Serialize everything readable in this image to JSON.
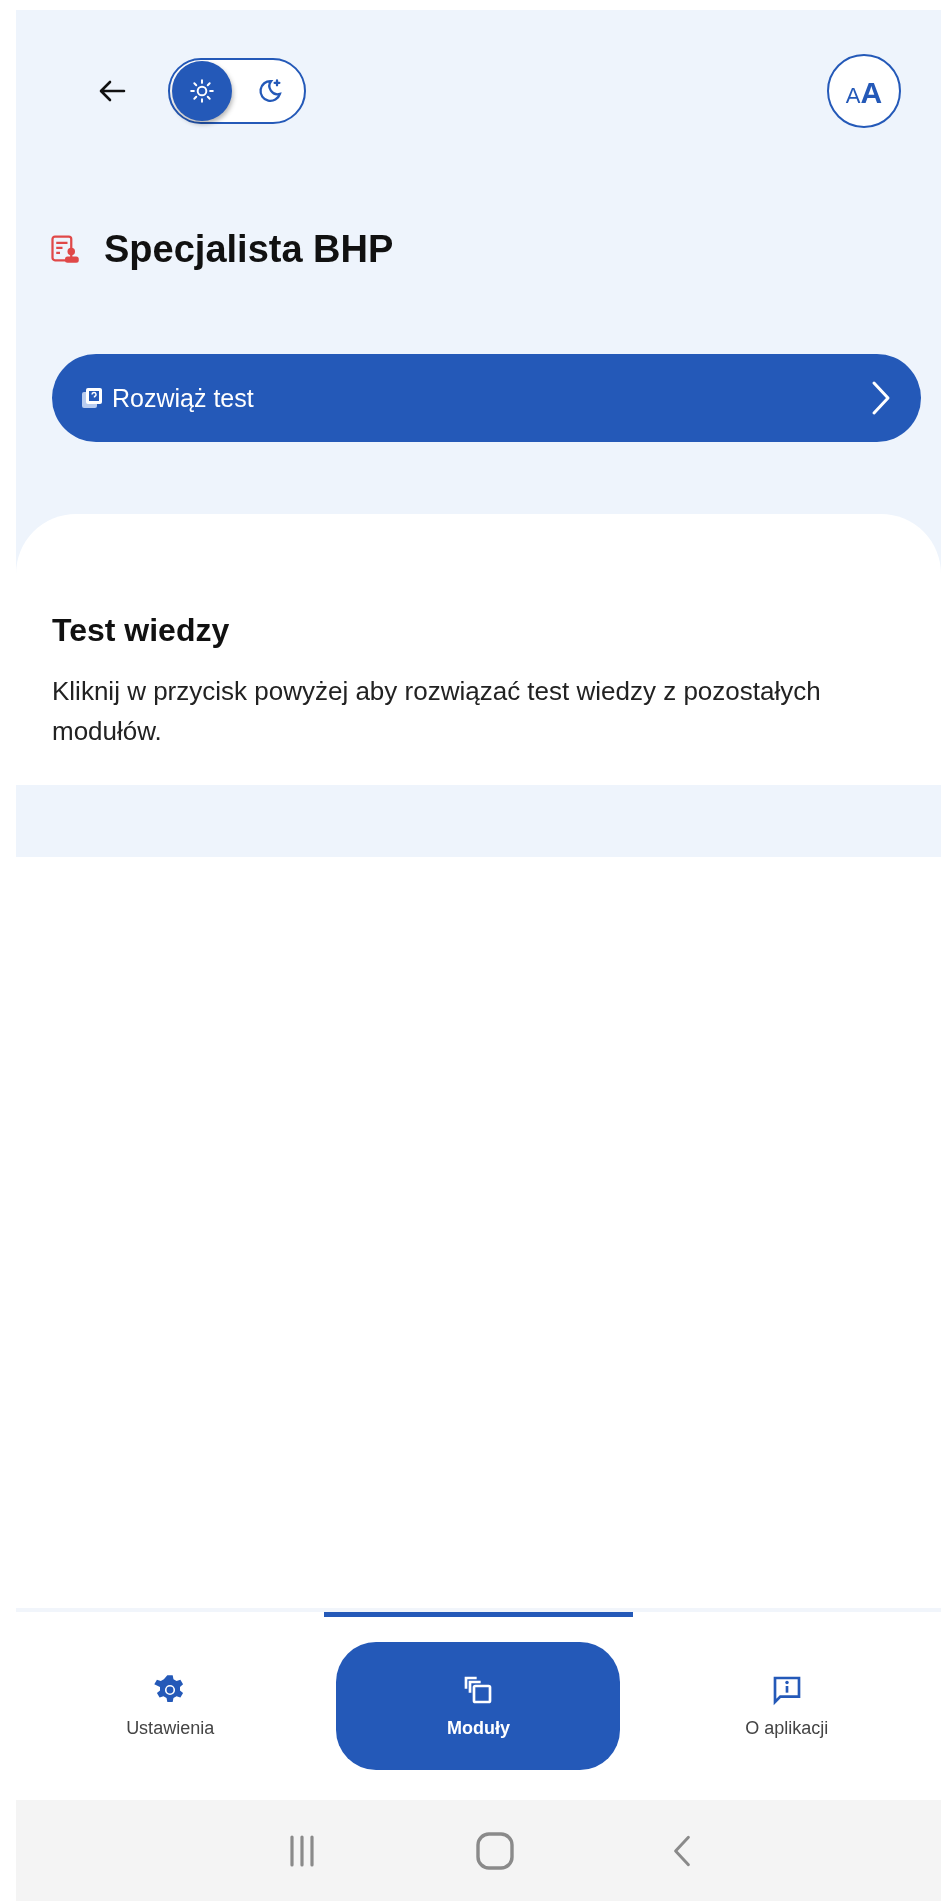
{
  "top_bar": {
    "theme_toggle": [
      {
        "kind": "light",
        "selected": true
      },
      {
        "kind": "dark",
        "selected": false
      }
    ],
    "text_size_button": {
      "small_letter": "A",
      "large_letter": "A"
    }
  },
  "title": "Specjalista BHP",
  "action_button": {
    "label": "Rozwiąż test"
  },
  "card": {
    "heading": "Test wiedzy",
    "text": "Kliknij w przycisk powyżej aby rozwiązać test wiedzy z pozostałych modułów."
  },
  "bottom_nav": [
    {
      "kind": "settings",
      "label": "Ustawienia",
      "selected": false
    },
    {
      "kind": "modules",
      "label": "Moduły",
      "selected": true
    },
    {
      "kind": "info",
      "label": "O aplikacji",
      "selected": false
    }
  ]
}
